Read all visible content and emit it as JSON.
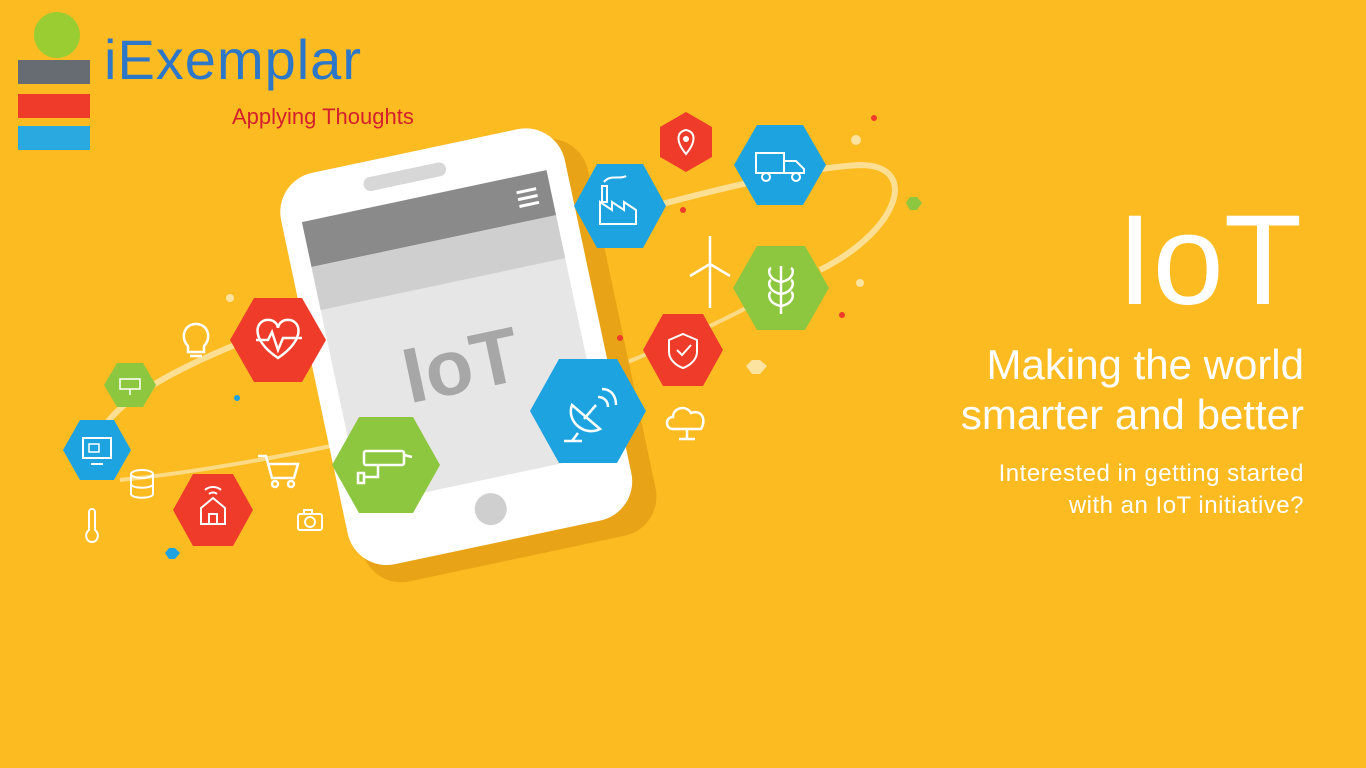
{
  "brand": {
    "name": "iExemplar",
    "tagline": "Applying Thoughts"
  },
  "hero": {
    "title": "IoT",
    "subtitle_line1": "Making the world",
    "subtitle_line2": "smarter and better",
    "question_line1": "Interested in getting started",
    "question_line2": "with an IoT initiative?"
  },
  "phone": {
    "screen_label": "IoT"
  },
  "icons": [
    "location-pin-icon",
    "truck-icon",
    "factory-icon",
    "wind-turbine-icon",
    "wheat-icon",
    "shield-check-icon",
    "satellite-dish-icon",
    "cloud-icon",
    "heart-rate-icon",
    "lightbulb-icon",
    "solar-panel-icon",
    "monitor-icon",
    "database-icon",
    "shopping-cart-icon",
    "cctv-camera-icon",
    "smart-home-icon",
    "thermometer-icon",
    "camera-icon"
  ],
  "colors": {
    "background": "#fdbb22",
    "red": "#ee3b2a",
    "blue": "#1ea3e1",
    "green": "#8dc63f",
    "brand_blue": "#2d77c9",
    "brand_red": "#d3202c"
  }
}
